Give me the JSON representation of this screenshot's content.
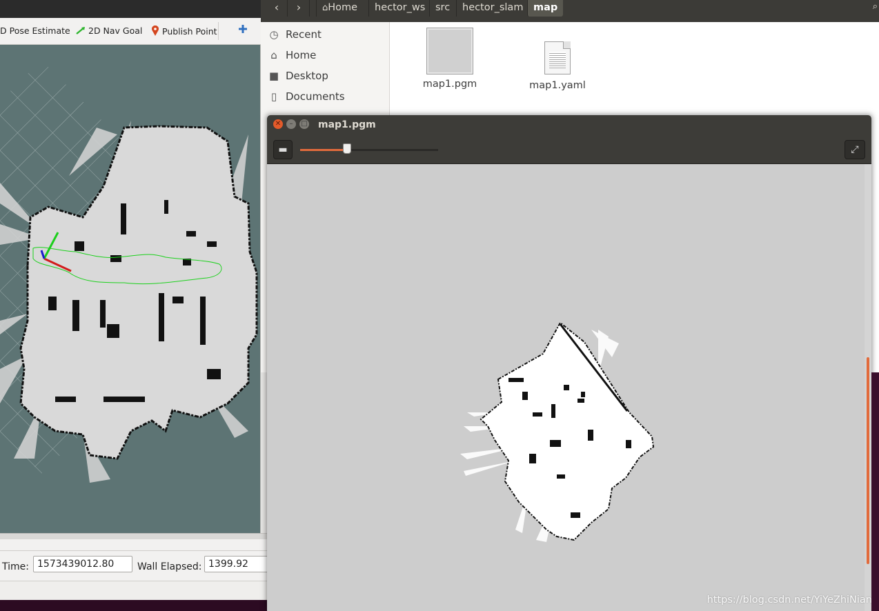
{
  "rviz": {
    "tools": [
      {
        "label": "D Pose Estimate",
        "icon": "pose-estimate-icon"
      },
      {
        "label": "2D Nav Goal",
        "icon": "nav-goal-arrow-icon",
        "color": "#2db52d"
      },
      {
        "label": "Publish Point",
        "icon": "map-pin-icon",
        "color": "#d4461f"
      },
      {
        "label": "",
        "icon": "plus-icon",
        "color": "#2f6fbf"
      }
    ],
    "time_label": "Time:",
    "time_value": "1573439012.80",
    "wall_elapsed_label": "Wall Elapsed:",
    "wall_elapsed_value": "1399.92"
  },
  "files": {
    "breadcrumbs": [
      "Home",
      "hector_ws",
      "src",
      "hector_slam",
      "map"
    ],
    "active_crumb": "map",
    "sidebar": [
      {
        "label": "Recent",
        "icon": "clock-icon"
      },
      {
        "label": "Home",
        "icon": "home-icon"
      },
      {
        "label": "Desktop",
        "icon": "folder-icon"
      },
      {
        "label": "Documents",
        "icon": "document-icon"
      }
    ],
    "items": [
      {
        "name": "map1.pgm",
        "icon": "image-thumbnail-icon"
      },
      {
        "name": "map1.yaml",
        "icon": "text-file-icon"
      }
    ]
  },
  "viewer": {
    "title": "map1.pgm",
    "zoom_level": 0.34,
    "accent_color": "#e26b3c"
  },
  "watermark": "https://blog.csdn.net/YiYeZhiNian"
}
